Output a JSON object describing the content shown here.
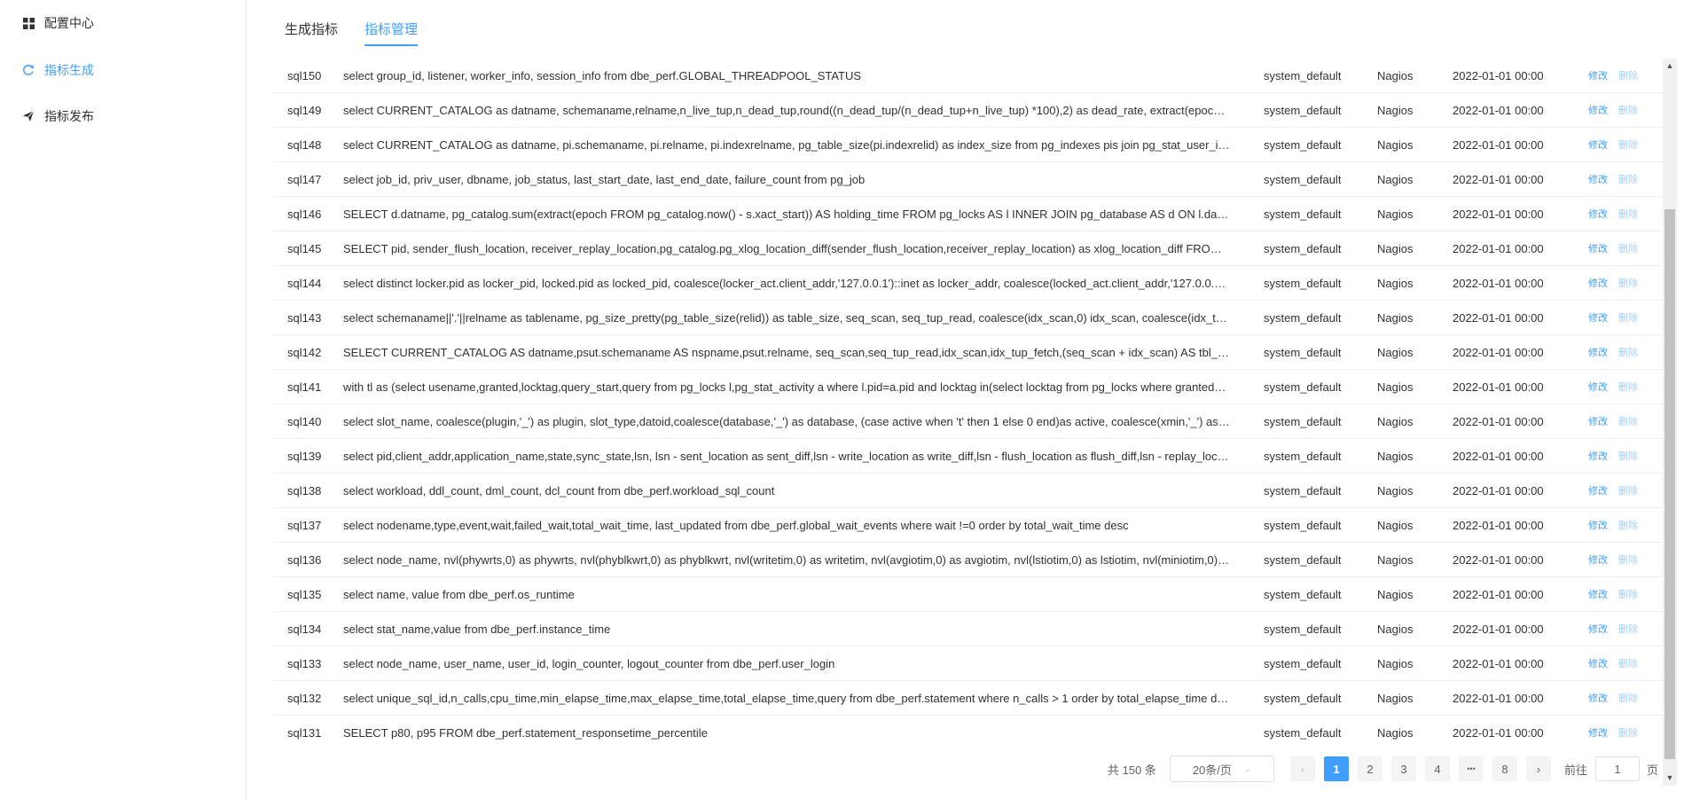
{
  "sidebar": {
    "items": [
      {
        "label": "配置中心",
        "icon": "grid-icon"
      },
      {
        "label": "指标生成",
        "icon": "refresh-icon"
      },
      {
        "label": "指标发布",
        "icon": "send-icon"
      }
    ],
    "active_index": 1
  },
  "tabs": [
    {
      "label": "生成指标"
    },
    {
      "label": "指标管理"
    }
  ],
  "active_tab": 1,
  "table": {
    "actions": {
      "edit": "修改",
      "delete": "删除"
    },
    "rows": [
      {
        "id": "sql150",
        "sql": "select group_id, listener, worker_info, session_info from dbe_perf.GLOBAL_THREADPOOL_STATUS",
        "user": "system_default",
        "type": "Nagios",
        "time": "2022-01-01 00:00"
      },
      {
        "id": "sql149",
        "sql": "select CURRENT_CATALOG as datname, schemaname,relname,n_live_tup,n_dead_tup,round((n_dead_tup/(n_dead_tup+n_live_tup) *100),2) as dead_rate, extract(epoc…",
        "user": "system_default",
        "type": "Nagios",
        "time": "2022-01-01 00:00"
      },
      {
        "id": "sql148",
        "sql": "select CURRENT_CATALOG as datname, pi.schemaname, pi.relname, pi.indexrelname, pg_table_size(pi.indexrelid) as index_size from pg_indexes pis join pg_stat_user_i…",
        "user": "system_default",
        "type": "Nagios",
        "time": "2022-01-01 00:00"
      },
      {
        "id": "sql147",
        "sql": "select job_id, priv_user, dbname, job_status, last_start_date, last_end_date, failure_count from pg_job",
        "user": "system_default",
        "type": "Nagios",
        "time": "2022-01-01 00:00"
      },
      {
        "id": "sql146",
        "sql": "SELECT d.datname, pg_catalog.sum(extract(epoch FROM pg_catalog.now() - s.xact_start)) AS holding_time FROM pg_locks AS l INNER JOIN pg_database AS d ON l.da…",
        "user": "system_default",
        "type": "Nagios",
        "time": "2022-01-01 00:00"
      },
      {
        "id": "sql145",
        "sql": "SELECT pid, sender_flush_location, receiver_replay_location,pg_catalog.pg_xlog_location_diff(sender_flush_location,receiver_replay_location) as xlog_location_diff FRO…",
        "user": "system_default",
        "type": "Nagios",
        "time": "2022-01-01 00:00"
      },
      {
        "id": "sql144",
        "sql": "select distinct locker.pid as locker_pid, locked.pid as locked_pid, coalesce(locker_act.client_addr,'127.0.0.1')::inet as locker_addr, coalesce(locked_act.client_addr,'127.0.0.…",
        "user": "system_default",
        "type": "Nagios",
        "time": "2022-01-01 00:00"
      },
      {
        "id": "sql143",
        "sql": "select schemaname||'.'||relname as tablename, pg_size_pretty(pg_table_size(relid)) as table_size, seq_scan, seq_tup_read, coalesce(idx_scan,0) idx_scan, coalesce(idx_t…",
        "user": "system_default",
        "type": "Nagios",
        "time": "2022-01-01 00:00"
      },
      {
        "id": "sql142",
        "sql": "SELECT CURRENT_CATALOG AS datname,psut.schemaname AS nspname,psut.relname, seq_scan,seq_tup_read,idx_scan,idx_tup_fetch,(seq_scan + idx_scan) AS tbl_…",
        "user": "system_default",
        "type": "Nagios",
        "time": "2022-01-01 00:00"
      },
      {
        "id": "sql141",
        "sql": "with tl as (select usename,granted,locktag,query_start,query from pg_locks l,pg_stat_activity a where l.pid=a.pid and locktag in(select locktag from pg_locks where granted…",
        "user": "system_default",
        "type": "Nagios",
        "time": "2022-01-01 00:00"
      },
      {
        "id": "sql140",
        "sql": "select slot_name, coalesce(plugin,'_') as plugin, slot_type,datoid,coalesce(database,'_') as database, (case active when 't' then 1 else 0 end)as active, coalesce(xmin,'_') as…",
        "user": "system_default",
        "type": "Nagios",
        "time": "2022-01-01 00:00"
      },
      {
        "id": "sql139",
        "sql": "select pid,client_addr,application_name,state,sync_state,lsn, lsn - sent_location as sent_diff,lsn - write_location as write_diff,lsn - flush_location as flush_diff,lsn - replay_loc…",
        "user": "system_default",
        "type": "Nagios",
        "time": "2022-01-01 00:00"
      },
      {
        "id": "sql138",
        "sql": "select workload, ddl_count, dml_count, dcl_count from dbe_perf.workload_sql_count",
        "user": "system_default",
        "type": "Nagios",
        "time": "2022-01-01 00:00"
      },
      {
        "id": "sql137",
        "sql": "select nodename,type,event,wait,failed_wait,total_wait_time, last_updated from dbe_perf.global_wait_events where wait !=0 order by total_wait_time desc",
        "user": "system_default",
        "type": "Nagios",
        "time": "2022-01-01 00:00"
      },
      {
        "id": "sql136",
        "sql": "select node_name, nvl(phywrts,0) as phywrts, nvl(phyblkwrt,0) as phyblkwrt, nvl(writetim,0) as writetim, nvl(avgiotim,0) as avgiotim, nvl(lstiotim,0) as lstiotim, nvl(miniotim,0)…",
        "user": "system_default",
        "type": "Nagios",
        "time": "2022-01-01 00:00"
      },
      {
        "id": "sql135",
        "sql": "select name, value from dbe_perf.os_runtime",
        "user": "system_default",
        "type": "Nagios",
        "time": "2022-01-01 00:00"
      },
      {
        "id": "sql134",
        "sql": "select stat_name,value from dbe_perf.instance_time",
        "user": "system_default",
        "type": "Nagios",
        "time": "2022-01-01 00:00"
      },
      {
        "id": "sql133",
        "sql": "select node_name, user_name, user_id, login_counter, logout_counter from dbe_perf.user_login",
        "user": "system_default",
        "type": "Nagios",
        "time": "2022-01-01 00:00"
      },
      {
        "id": "sql132",
        "sql": "select unique_sql_id,n_calls,cpu_time,min_elapse_time,max_elapse_time,total_elapse_time,query from dbe_perf.statement where n_calls > 1 order by total_elapse_time d…",
        "user": "system_default",
        "type": "Nagios",
        "time": "2022-01-01 00:00"
      },
      {
        "id": "sql131",
        "sql": "SELECT p80, p95 FROM dbe_perf.statement_responsetime_percentile",
        "user": "system_default",
        "type": "Nagios",
        "time": "2022-01-01 00:00"
      }
    ]
  },
  "pagination": {
    "total_text": "共 150 条",
    "page_size": "20条/页",
    "pages": [
      "1",
      "2",
      "3",
      "4",
      "•••",
      "8"
    ],
    "current_page": "1",
    "goto_label": "前往",
    "goto_value": "1",
    "goto_suffix": "页",
    "prev_icon": "chevron-left-icon",
    "next_icon": "chevron-right-icon"
  },
  "colors": {
    "accent": "#409eff",
    "delete_link": "#a0cfff",
    "text": "#303133",
    "border": "#ebeef5"
  }
}
